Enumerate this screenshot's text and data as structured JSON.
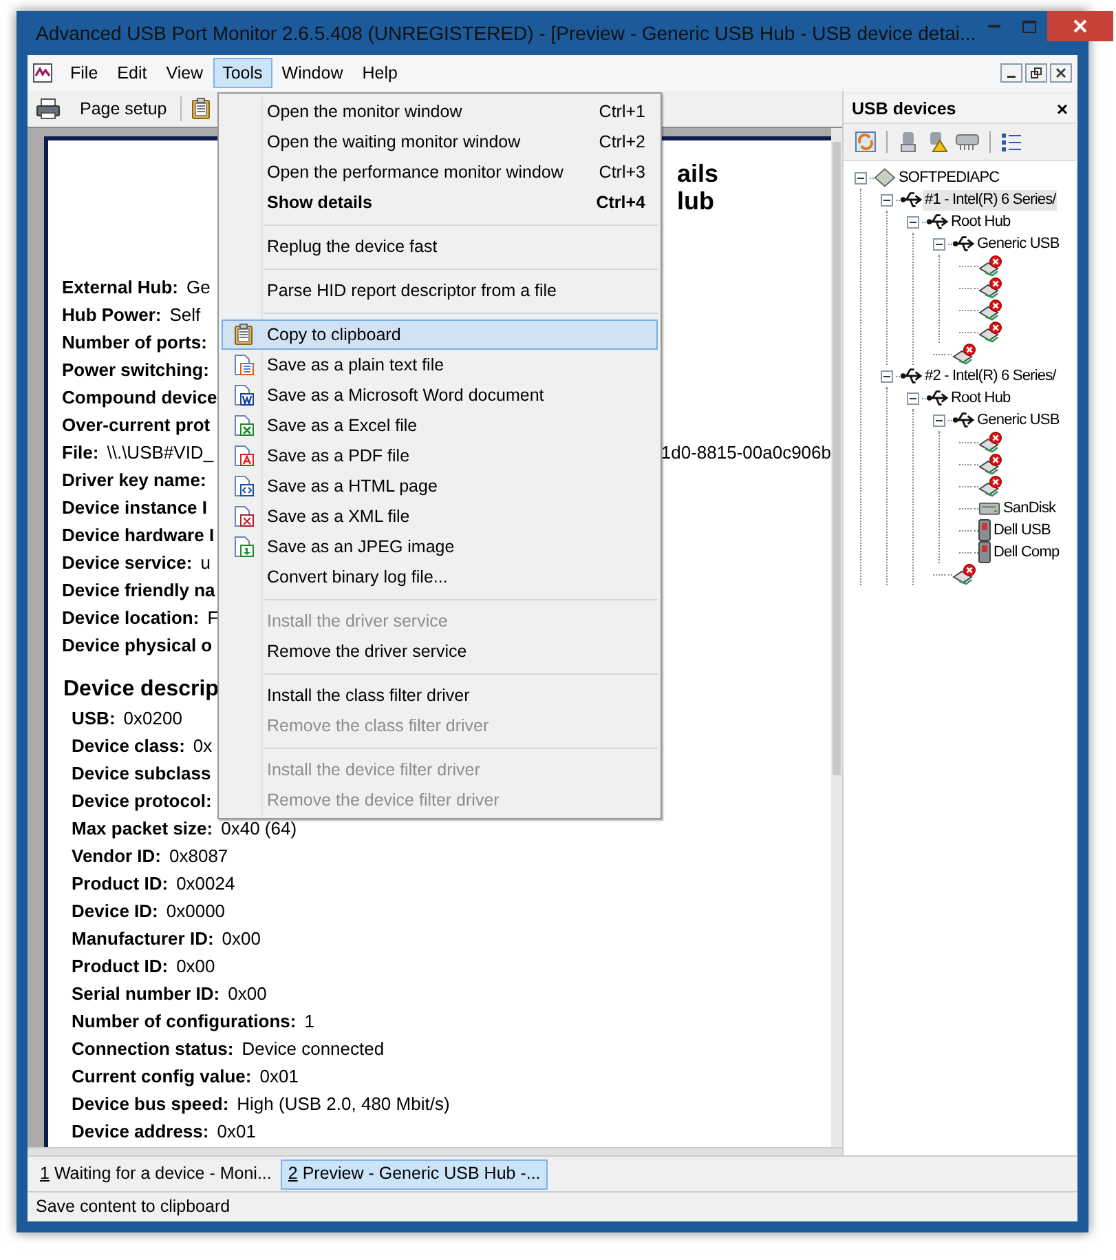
{
  "window": {
    "title": "Advanced USB Port Monitor 2.6.5.408 (UNREGISTERED) - [Preview - Generic USB Hub - USB device detai..."
  },
  "menubar": [
    {
      "label": "File",
      "selected": false
    },
    {
      "label": "Edit",
      "selected": false
    },
    {
      "label": "View",
      "selected": false
    },
    {
      "label": "Tools",
      "selected": true
    },
    {
      "label": "Window",
      "selected": false
    },
    {
      "label": "Help",
      "selected": false
    }
  ],
  "toolbar": {
    "page_setup": "Page setup"
  },
  "document": {
    "title_lines": [
      "ails",
      "lub"
    ],
    "hub_fields": [
      {
        "label": "External Hub:",
        "value": "Ge"
      },
      {
        "label": "Hub Power:",
        "value": "Self"
      },
      {
        "label": "Number of ports:"
      },
      {
        "label": "Power switching:"
      },
      {
        "label": "Compound device"
      },
      {
        "label": "Over-current prot"
      },
      {
        "label": "File:",
        "value": "\\\\.\\USB#VID_",
        "value_right": "1d0-8815-00a0c906b"
      },
      {
        "label": "Driver key name:"
      },
      {
        "label": "Device instance I"
      },
      {
        "label": "Device hardware I"
      },
      {
        "label": "Device service:",
        "value": "u"
      },
      {
        "label": "Device friendly na"
      },
      {
        "label": "Device location:",
        "value": "F"
      },
      {
        "label": "Device physical o"
      }
    ],
    "descriptor_heading": "Device descrip",
    "descriptor_fields": [
      {
        "label": "USB:",
        "value": "0x0200"
      },
      {
        "label": "Device class:",
        "value": "0x"
      },
      {
        "label": "Device subclass"
      },
      {
        "label": "Device protocol:"
      },
      {
        "label": "Max packet size:",
        "value": "0x40 (64)"
      },
      {
        "label": "Vendor ID:",
        "value": "0x8087"
      },
      {
        "label": "Product ID:",
        "value": "0x0024"
      },
      {
        "label": "Device ID:",
        "value": "0x0000"
      },
      {
        "label": "Manufacturer ID:",
        "value": "0x00"
      },
      {
        "label": "Product ID:",
        "value": "0x00"
      },
      {
        "label": "Serial number ID:",
        "value": "0x00"
      },
      {
        "label": "Number of configurations:",
        "value": "1"
      },
      {
        "label": "Connection status:",
        "value": "Device connected"
      },
      {
        "label": "Current config value:",
        "value": "0x01"
      },
      {
        "label": "Device bus speed:",
        "value": "High (USB 2.0, 480 Mbit/s)"
      },
      {
        "label": "Device address:",
        "value": "0x01"
      }
    ]
  },
  "tools_menu": [
    {
      "kind": "item",
      "label": "Open the monitor window",
      "shortcut": "Ctrl+1",
      "disabled": false,
      "selected": false
    },
    {
      "kind": "item",
      "label": "Open the waiting monitor window",
      "shortcut": "Ctrl+2",
      "disabled": false,
      "selected": false
    },
    {
      "kind": "item",
      "label": "Open the performance monitor window",
      "shortcut": "Ctrl+3",
      "disabled": false,
      "selected": false
    },
    {
      "kind": "item",
      "label": "Show details",
      "shortcut": "Ctrl+4",
      "default": true,
      "disabled": false,
      "selected": false
    },
    {
      "kind": "separator"
    },
    {
      "kind": "item",
      "label": "Replug the device fast",
      "disabled": false,
      "selected": false
    },
    {
      "kind": "separator"
    },
    {
      "kind": "item",
      "label": "Parse HID report descriptor from a file",
      "disabled": false,
      "selected": false
    },
    {
      "kind": "separator"
    },
    {
      "kind": "item",
      "label": "Copy to clipboard",
      "icon": true,
      "disabled": false,
      "selected": true
    },
    {
      "kind": "item",
      "label": "Save as a plain text file",
      "icon": true,
      "disabled": false,
      "selected": false
    },
    {
      "kind": "item",
      "label": "Save as a Microsoft Word document",
      "icon": true,
      "disabled": false,
      "selected": false
    },
    {
      "kind": "item",
      "label": "Save as a Excel file",
      "icon": true,
      "disabled": false,
      "selected": false
    },
    {
      "kind": "item",
      "label": "Save as a PDF file",
      "icon": true,
      "disabled": false,
      "selected": false
    },
    {
      "kind": "item",
      "label": "Save as a HTML page",
      "icon": true,
      "disabled": false,
      "selected": false
    },
    {
      "kind": "item",
      "label": "Save as a XML file",
      "icon": true,
      "disabled": false,
      "selected": false
    },
    {
      "kind": "item",
      "label": "Save as an JPEG image",
      "icon": true,
      "disabled": false,
      "selected": false
    },
    {
      "kind": "item",
      "label": "Convert binary log file...",
      "disabled": false,
      "selected": false
    },
    {
      "kind": "separator"
    },
    {
      "kind": "item",
      "label": "Install the driver service",
      "disabled": true,
      "selected": false
    },
    {
      "kind": "item",
      "label": "Remove the driver service",
      "disabled": false,
      "selected": false
    },
    {
      "kind": "separator"
    },
    {
      "kind": "item",
      "label": "Install the class filter driver",
      "disabled": false,
      "selected": false
    },
    {
      "kind": "item",
      "label": "Remove the class filter driver",
      "disabled": true,
      "selected": false
    },
    {
      "kind": "separator"
    },
    {
      "kind": "item",
      "label": "Install the device filter driver",
      "disabled": true,
      "selected": false
    },
    {
      "kind": "item",
      "label": "Remove the device filter driver",
      "disabled": true,
      "selected": false
    }
  ],
  "usb_panel": {
    "title": "USB devices",
    "close": "×",
    "tree": [
      {
        "kind": "computer",
        "label": "SOFTPEDIAPC",
        "expanded": true,
        "selected": false,
        "children": [
          {
            "kind": "hub",
            "label": "#1 - Intel(R) 6 Series/",
            "expanded": true,
            "selected": true,
            "children": [
              {
                "kind": "hub",
                "label": "Root Hub",
                "expanded": true,
                "selected": false,
                "children": [
                  {
                    "kind": "hub",
                    "label": "Generic USB",
                    "expanded": true,
                    "selected": false,
                    "children": [
                      {
                        "kind": "disconnected",
                        "selected": false
                      },
                      {
                        "kind": "disconnected",
                        "selected": false
                      },
                      {
                        "kind": "disconnected",
                        "selected": false
                      },
                      {
                        "kind": "disconnected",
                        "selected": false
                      }
                    ]
                  },
                  {
                    "kind": "disconnected",
                    "selected": false
                  }
                ]
              }
            ]
          },
          {
            "kind": "hub",
            "label": "#2 - Intel(R) 6 Series/",
            "expanded": true,
            "selected": false,
            "children": [
              {
                "kind": "hub",
                "label": "Root Hub",
                "expanded": true,
                "selected": false,
                "children": [
                  {
                    "kind": "hub",
                    "label": "Generic USB",
                    "expanded": true,
                    "selected": false,
                    "children": [
                      {
                        "kind": "disconnected",
                        "selected": false
                      },
                      {
                        "kind": "disconnected",
                        "selected": false
                      },
                      {
                        "kind": "disconnected",
                        "selected": false
                      },
                      {
                        "kind": "drive",
                        "label": "SanDisk",
                        "selected": false
                      },
                      {
                        "kind": "device",
                        "label": "Dell USB",
                        "selected": false
                      },
                      {
                        "kind": "device",
                        "label": "Dell Comp",
                        "selected": false
                      }
                    ]
                  },
                  {
                    "kind": "disconnected",
                    "selected": false
                  }
                ]
              }
            ]
          }
        ]
      }
    ]
  },
  "tabs": [
    {
      "number": "1",
      "label": "Waiting for a device - Moni...",
      "selected": false
    },
    {
      "number": "2",
      "label": "Preview - Generic USB Hub -...",
      "selected": true
    }
  ],
  "status_bar": "Save content to clipboard"
}
